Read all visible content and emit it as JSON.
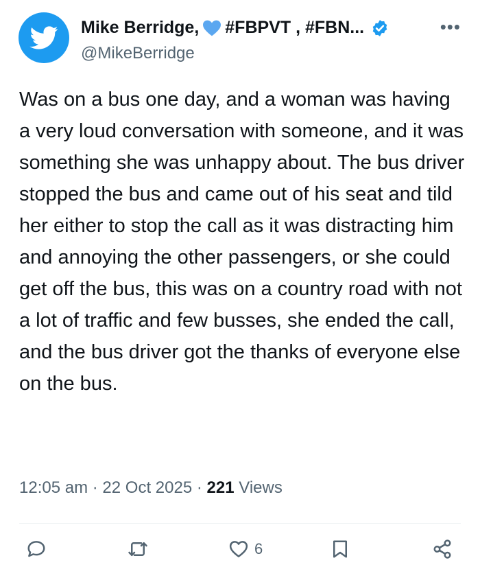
{
  "author": {
    "name": "Mike Berridge,",
    "tags": "#FBPVT , #FBN...",
    "handle": "@MikeBerridge",
    "heart_color": "#5ba7f0",
    "verified_color": "#1d9bf0"
  },
  "tweet": {
    "text": "Was on a bus one day, and a woman was having a very loud conversation with someone, and it was something she was unhappy about. The bus driver stopped the bus and came out of his seat and tild her either to stop the call as it was distracting him and annoying the other passengers, or she could get off the bus, this was on a country road with not a lot of traffic and few busses, she ended the call, and the bus driver got the thanks of everyone else on the bus."
  },
  "meta": {
    "time": "12:05 am",
    "sep1": "·",
    "date": "22 Oct 2025",
    "sep2": "·",
    "views_count": "221",
    "views_label": "Views"
  },
  "actions": {
    "like_count": "6"
  },
  "icons": {
    "avatar": "twitter-bird-icon",
    "more": "more-icon",
    "reply": "reply-icon",
    "retweet": "retweet-icon",
    "like": "heart-icon",
    "bookmark": "bookmark-icon",
    "share": "share-icon"
  },
  "colors": {
    "accent": "#1d9bf0",
    "secondary_text": "#536471"
  }
}
